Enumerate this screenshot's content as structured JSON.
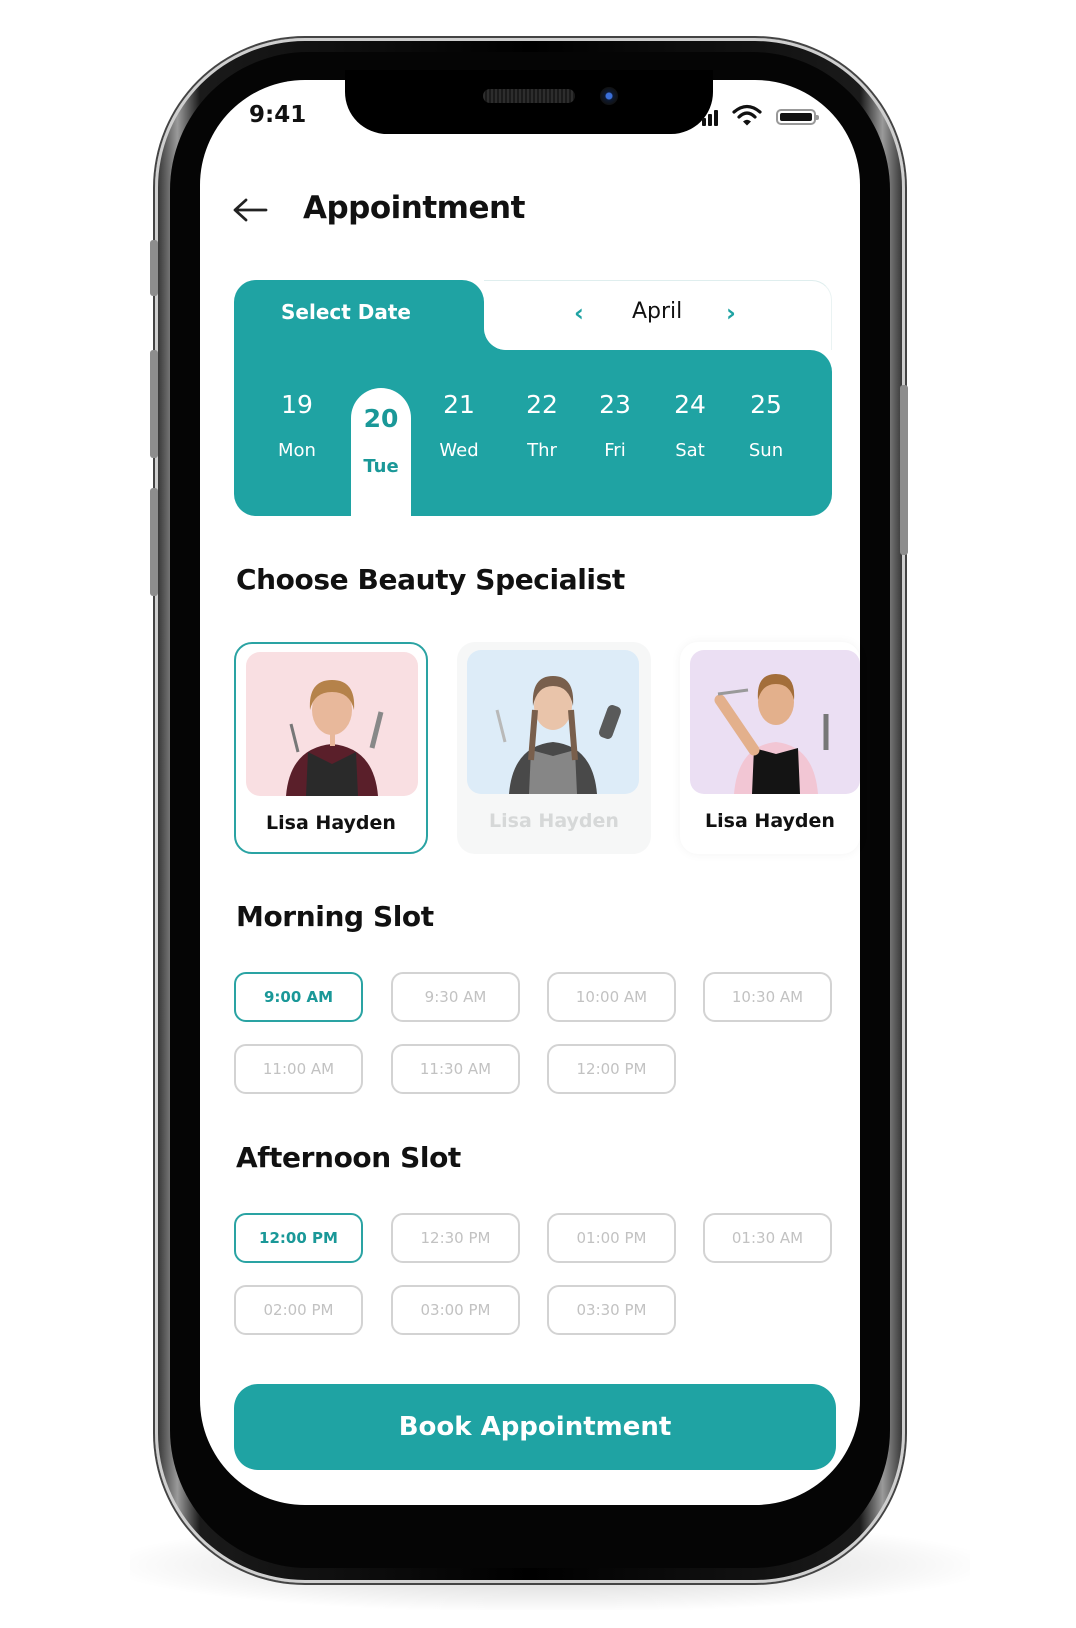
{
  "status_bar": {
    "time": "9:41",
    "icons": [
      "signal-icon",
      "wifi-icon",
      "battery-icon"
    ]
  },
  "header": {
    "back_icon": "arrow-left-icon",
    "title": "Appointment"
  },
  "date_picker": {
    "tab_label": "Select Date",
    "month": "April",
    "prev_icon": "chevron-left-icon",
    "next_icon": "chevron-right-icon",
    "accent_color": "#1fa3a3",
    "days": [
      {
        "num": "19",
        "dow": "Mon",
        "selected": false
      },
      {
        "num": "20",
        "dow": "Tue",
        "selected": true
      },
      {
        "num": "21",
        "dow": "Wed",
        "selected": false
      },
      {
        "num": "22",
        "dow": "Thr",
        "selected": false
      },
      {
        "num": "23",
        "dow": "Fri",
        "selected": false
      },
      {
        "num": "24",
        "dow": "Sat",
        "selected": false
      },
      {
        "num": "25",
        "dow": "Sun",
        "selected": false
      }
    ]
  },
  "specialists": {
    "title": "Choose Beauty Specialist",
    "items": [
      {
        "name": "Lisa Hayden",
        "state": "selected",
        "bg_color": "#f9dfe2"
      },
      {
        "name": "Lisa Hayden",
        "state": "disabled",
        "bg_color": "#d7eaf9"
      },
      {
        "name": "Lisa Hayden",
        "state": "available",
        "bg_color": "#ebdff3"
      }
    ]
  },
  "morning": {
    "title": "Morning Slot",
    "slots": [
      {
        "label": "9:00 AM",
        "selected": true
      },
      {
        "label": "9:30 AM",
        "selected": false
      },
      {
        "label": "10:00 AM",
        "selected": false
      },
      {
        "label": "10:30 AM",
        "selected": false
      },
      {
        "label": "11:00 AM",
        "selected": false
      },
      {
        "label": "11:30 AM",
        "selected": false
      },
      {
        "label": "12:00 PM",
        "selected": false
      }
    ]
  },
  "afternoon": {
    "title": "Afternoon Slot",
    "slots": [
      {
        "label": "12:00 PM",
        "selected": true
      },
      {
        "label": "12:30 PM",
        "selected": false
      },
      {
        "label": "01:00 PM",
        "selected": false
      },
      {
        "label": "01:30 AM",
        "selected": false
      },
      {
        "label": "02:00 PM",
        "selected": false
      },
      {
        "label": "03:00 PM",
        "selected": false
      },
      {
        "label": "03:30 PM",
        "selected": false
      }
    ]
  },
  "cta": {
    "label": "Book Appointment"
  }
}
